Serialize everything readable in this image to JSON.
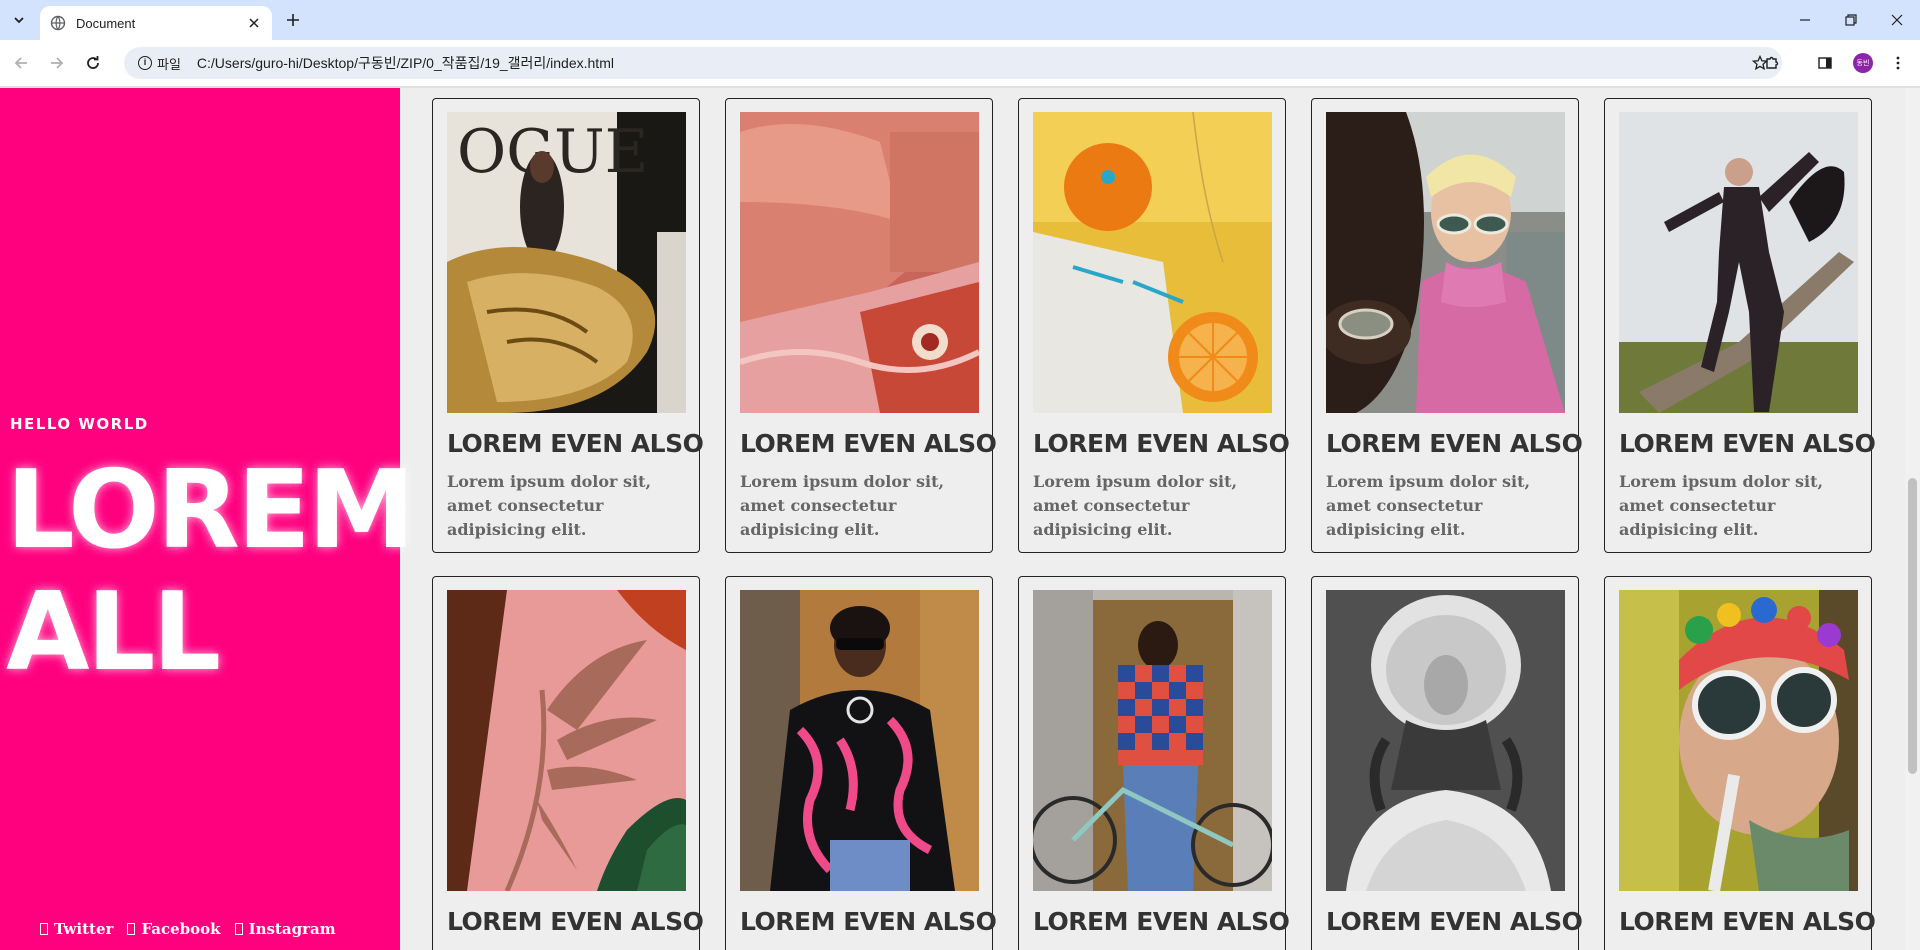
{
  "browser": {
    "tab_title": "Document",
    "site_chip": "파일",
    "url": "C:/Users/guro-hi/Desktop/구동빈/ZIP/0_작품집/19_갤러리/index.html",
    "avatar_text": "동빈"
  },
  "sidebar": {
    "kicker": "HELLO WORLD",
    "hero_line1": "LOREM",
    "hero_line2": "ALL",
    "social": [
      "Twitter",
      "Facebook",
      "Instagram"
    ],
    "accent_color": "#ff007f"
  },
  "cards": [
    {
      "title": "LOREM EVEN ALSO",
      "text": "Lorem ipsum dolor sit, amet consectetur adipisicing elit.",
      "photo": "magazine-gold-bag"
    },
    {
      "title": "LOREM EVEN ALSO",
      "text": "Lorem ipsum dolor sit, amet consectetur adipisicing elit.",
      "photo": "pink-sofa-rug"
    },
    {
      "title": "LOREM EVEN ALSO",
      "text": "Lorem ipsum dolor sit, amet consectetur adipisicing elit.",
      "photo": "orange-jewelry"
    },
    {
      "title": "LOREM EVEN ALSO",
      "text": "Lorem ipsum dolor sit, amet consectetur adipisicing elit.",
      "photo": "sunglasses-pink-sweater"
    },
    {
      "title": "LOREM EVEN ALSO",
      "text": "Lorem ipsum dolor sit, amet consectetur adipisicing elit.",
      "photo": "suit-man-tree"
    },
    {
      "title": "LOREM EVEN ALSO",
      "text": "",
      "photo": "palm-shadow-pink"
    },
    {
      "title": "LOREM EVEN ALSO",
      "text": "",
      "photo": "woman-pink-jacket"
    },
    {
      "title": "LOREM EVEN ALSO",
      "text": "",
      "photo": "man-checkered-bike"
    },
    {
      "title": "LOREM EVEN ALSO",
      "text": "",
      "photo": "curly-hair-tulle"
    },
    {
      "title": "LOREM EVEN ALSO",
      "text": "",
      "photo": "man-colorful-hat"
    }
  ]
}
